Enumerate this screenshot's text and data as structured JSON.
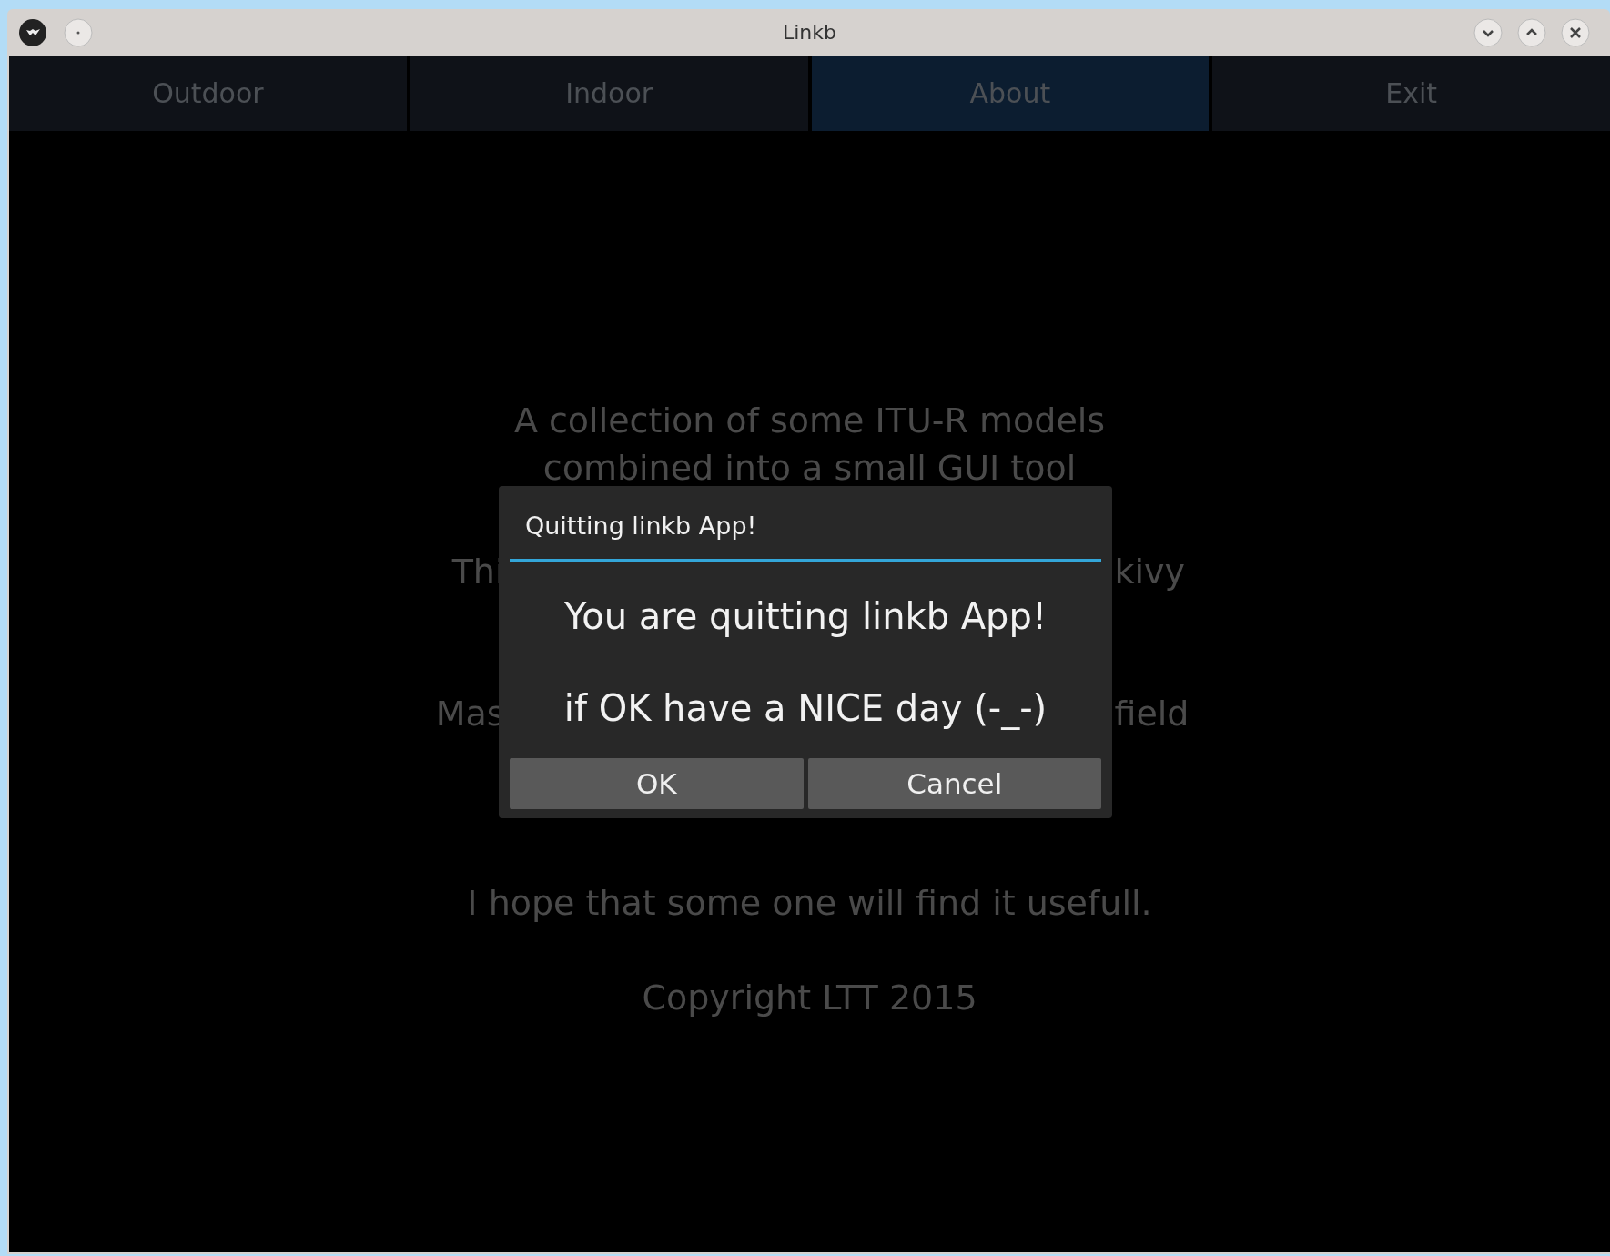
{
  "window": {
    "title": "Linkb"
  },
  "tabs": [
    {
      "label": "Outdoor",
      "selected": false
    },
    {
      "label": "Indoor",
      "selected": false
    },
    {
      "label": "About",
      "selected": true
    },
    {
      "label": "Exit",
      "selected": false
    }
  ],
  "about_lines": [
    {
      "kind": "whole",
      "text": "A collection of some ITU-R models"
    },
    {
      "kind": "whole",
      "text": "combined into a small GUI tool"
    },
    {
      "kind": "split",
      "left": "Thi",
      "right": "kivy"
    },
    {
      "kind": "split",
      "left": "Mas",
      "right": "field"
    },
    {
      "kind": "whole",
      "text": "I hope that some one will find it usefull."
    },
    {
      "kind": "whole",
      "text": "Copyright LTT 2015"
    }
  ],
  "dialog": {
    "title": "Quitting linkb App!",
    "message_lines": [
      "You are quitting linkb App!",
      "if OK have a NICE day (-_-)"
    ],
    "buttons": [
      "OK",
      "Cancel"
    ]
  }
}
